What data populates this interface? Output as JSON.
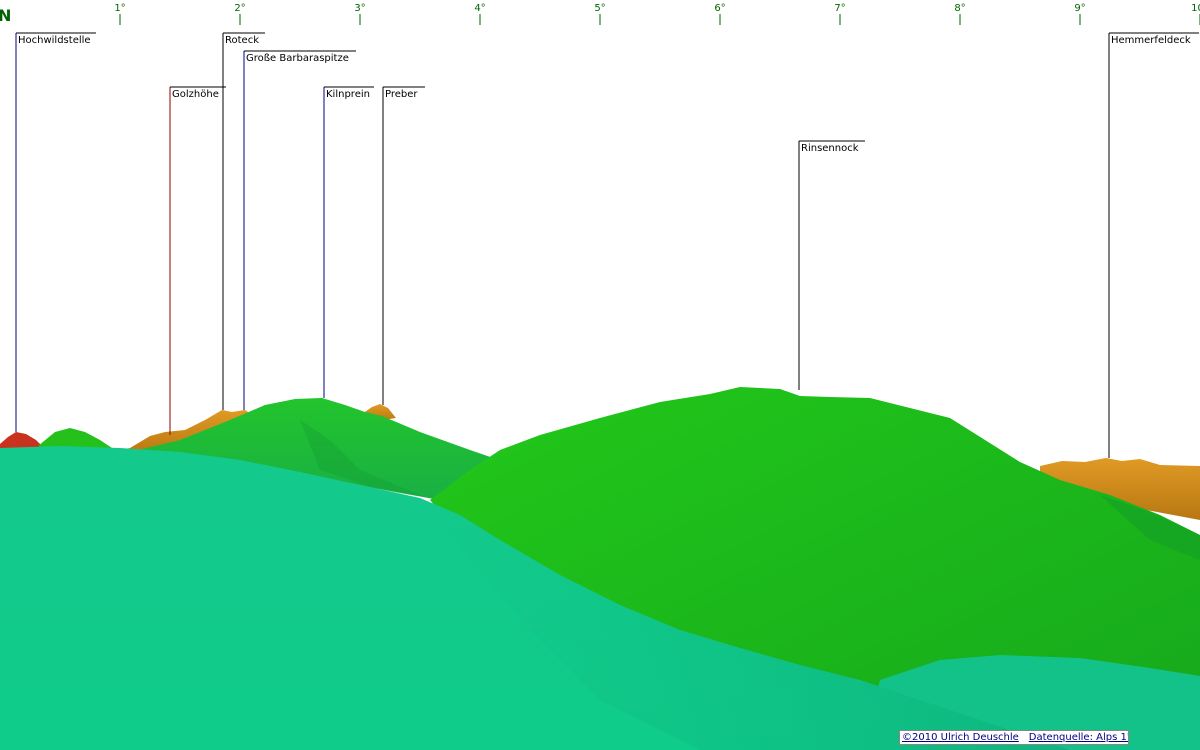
{
  "view": {
    "cardinal": "N",
    "degree_ticks": [
      "1°",
      "2°",
      "3°",
      "4°",
      "5°",
      "6°",
      "7°",
      "8°",
      "9°",
      "10°"
    ]
  },
  "peaks": [
    {
      "name": "Hochwildstelle",
      "line_color": "#00008b"
    },
    {
      "name": "Golzhöhe",
      "line_color": "#8b0000"
    },
    {
      "name": "Roteck",
      "line_color": "#000000"
    },
    {
      "name": "Große Barbaraspitze",
      "line_color": "#00008b"
    },
    {
      "name": "Kilnprein",
      "line_color": "#00008b"
    },
    {
      "name": "Preber",
      "line_color": "#000000"
    },
    {
      "name": "Rinsennock",
      "line_color": "#000000"
    },
    {
      "name": "Hemmerfeldeck",
      "line_color": "#000000"
    }
  ],
  "credits": {
    "copyright": "©2010 Ulrich Deuschle",
    "source": "Datenquelle: Alps 1\""
  },
  "colors": {
    "sky": "#ffffff",
    "scale": "#006400",
    "near_slope": "#12c98a",
    "mid_slope": "#1fbf3a",
    "far_slope": "#22c21a",
    "rock": "#d08a1a",
    "summit_red": "#c8321e"
  }
}
